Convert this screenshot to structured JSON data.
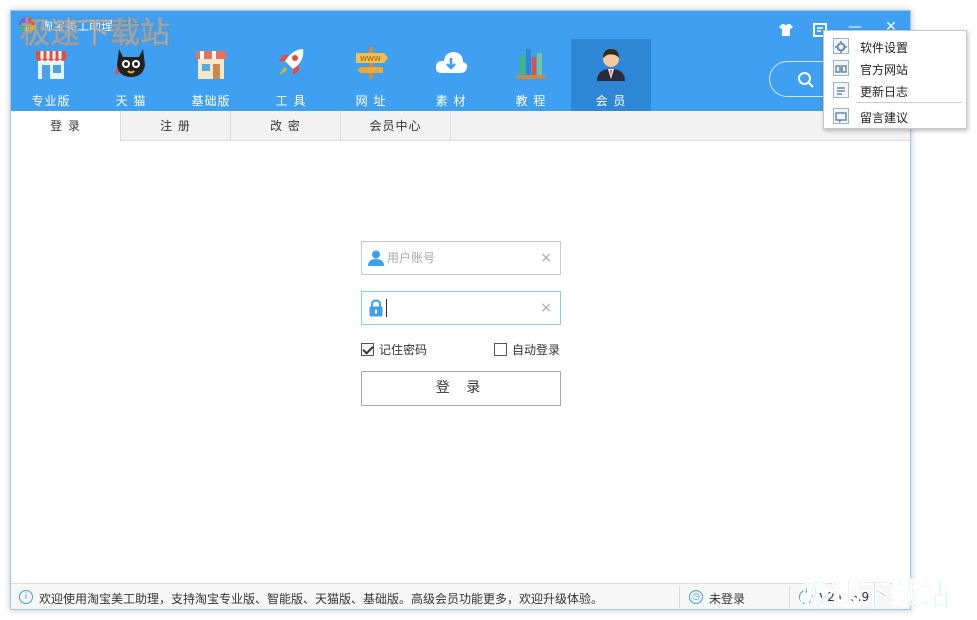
{
  "app": {
    "title": "淘宝美工助理"
  },
  "nav": [
    {
      "label": "专业版",
      "icon": "shop-awning-icon"
    },
    {
      "label": "天 猫",
      "icon": "tmall-cat-icon"
    },
    {
      "label": "基础版",
      "icon": "storefront-icon"
    },
    {
      "label": "工 具",
      "icon": "rocket-icon"
    },
    {
      "label": "网 址",
      "icon": "www-signpost-icon"
    },
    {
      "label": "素 材",
      "icon": "cloud-download-icon"
    },
    {
      "label": "教 程",
      "icon": "books-icon"
    },
    {
      "label": "会 员",
      "icon": "member-avatar-icon",
      "active": true
    }
  ],
  "tabs": [
    {
      "label": "登 录",
      "active": true
    },
    {
      "label": "注 册"
    },
    {
      "label": "改 密"
    },
    {
      "label": "会员中心"
    }
  ],
  "login": {
    "username_placeholder": "用户账号",
    "username_value": "",
    "password_value": "",
    "clear_glyph": "×",
    "remember_label": "记住密码",
    "remember_checked": true,
    "auto_login_label": "自动登录",
    "auto_login_checked": false,
    "submit_label": "登 录"
  },
  "status": {
    "message": "欢迎使用淘宝美工助理，支持淘宝专业版、智能版、天猫版、基础版。高级会员功能更多，欢迎升级体验。",
    "login_state": "未登录",
    "version": "V2.0.8.9"
  },
  "menu": {
    "items": [
      {
        "label": "软件设置",
        "icon": "gear-icon"
      },
      {
        "label": "官方网站",
        "icon": "web-link-icon"
      },
      {
        "label": "更新日志",
        "icon": "document-icon"
      },
      {
        "label": "留言建议",
        "icon": "message-icon"
      }
    ]
  },
  "watermarks": {
    "top": "极速下载站",
    "bottom": "极速下载站"
  },
  "colors": {
    "accent": "#3f9ff0",
    "nav_active": "#2d86d6"
  }
}
